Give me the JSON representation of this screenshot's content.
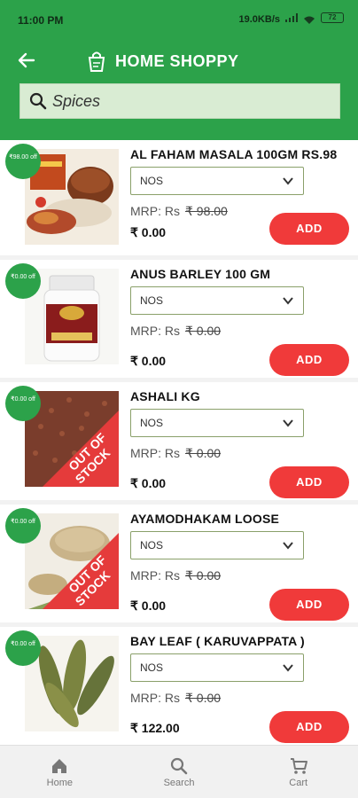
{
  "statusbar": {
    "time": "11:00 PM",
    "info": "19.0KB/s",
    "battery": "72"
  },
  "header": {
    "title": "HOME SHOPPY",
    "search_value": "Spices"
  },
  "products": [
    {
      "discount": "₹98.00 off",
      "name": "AL FAHAM MASALA 100GM RS.98",
      "unit": "NOS",
      "mrp_label": "MRP: Rs",
      "mrp": "₹ 98.00",
      "price": "₹ 0.00",
      "add_label": "ADD",
      "out_of_stock": false
    },
    {
      "discount": "₹0.00 off",
      "name": "ANUS BARLEY 100 GM",
      "unit": "NOS",
      "mrp_label": "MRP: Rs",
      "mrp": "₹ 0.00",
      "price": "₹ 0.00",
      "add_label": "ADD",
      "out_of_stock": false
    },
    {
      "discount": "₹0.00 off",
      "name": "ASHALI KG",
      "unit": "NOS",
      "mrp_label": "MRP: Rs",
      "mrp": "₹ 0.00",
      "price": "₹ 0.00",
      "add_label": "ADD",
      "out_of_stock": true
    },
    {
      "discount": "₹0.00 off",
      "name": "AYAMODHAKAM LOOSE",
      "unit": "NOS",
      "mrp_label": "MRP: Rs",
      "mrp": "₹ 0.00",
      "price": "₹ 0.00",
      "add_label": "ADD",
      "out_of_stock": true
    },
    {
      "discount": "₹0.00 off",
      "name": "BAY LEAF ( KARUVAPPATA )",
      "unit": "NOS",
      "mrp_label": "MRP: Rs",
      "mrp": "₹ 0.00",
      "price": "₹ 122.00",
      "add_label": "ADD",
      "out_of_stock": false
    }
  ],
  "out_of_stock_text": [
    "OUT OF",
    "STOCK"
  ],
  "bottom_nav": [
    {
      "label": "Home",
      "icon": "home-icon"
    },
    {
      "label": "Search",
      "icon": "search-icon"
    },
    {
      "label": "Cart",
      "icon": "cart-icon"
    }
  ],
  "colors": {
    "brand_green": "#2ca24a",
    "add_red": "#f03a3a",
    "search_bg": "#d9ecd3"
  }
}
